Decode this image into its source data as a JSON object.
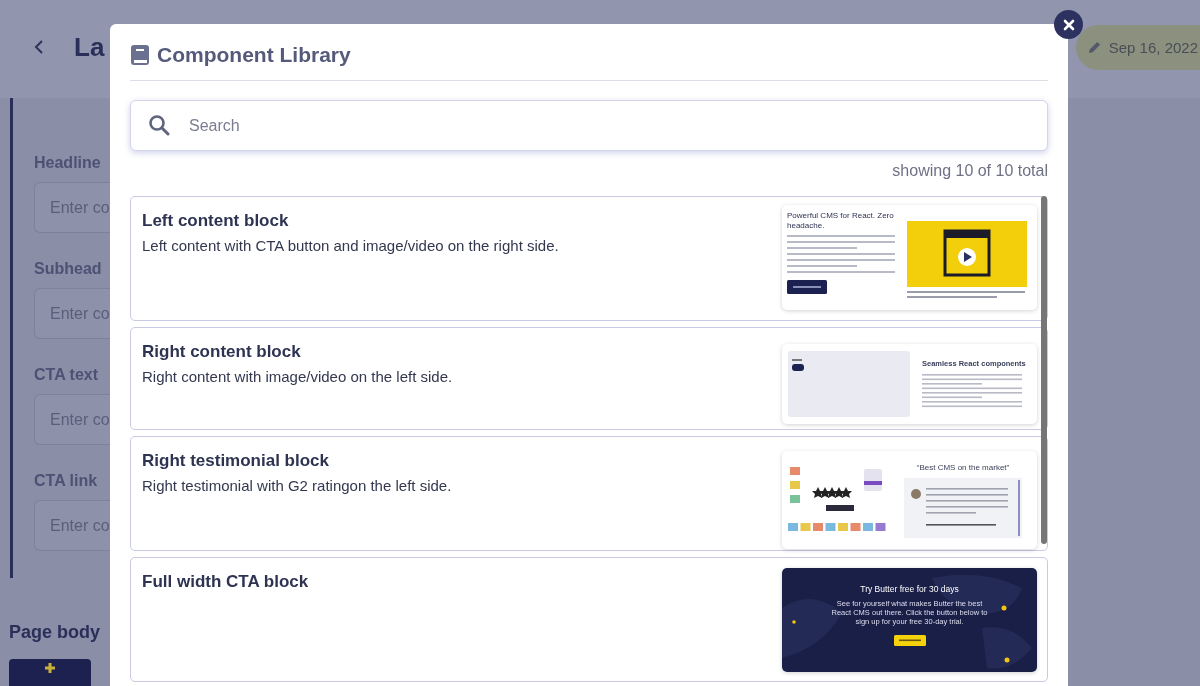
{
  "background_page": {
    "title": "La",
    "date_badge": "Sep 16, 2022",
    "fields": [
      {
        "label": "Headline",
        "placeholder": "Enter co"
      },
      {
        "label": "Subhead",
        "placeholder": "Enter co"
      },
      {
        "label": "CTA text",
        "placeholder": "Enter co"
      },
      {
        "label": "CTA link",
        "placeholder": "Enter co"
      }
    ],
    "section_title": "Page body"
  },
  "modal": {
    "title": "Component Library",
    "search": {
      "placeholder": "Search"
    },
    "result_count": "showing 10 of 10 total",
    "components": [
      {
        "name": "Left content block",
        "description": "Left content with CTA button and image/video on the right side.",
        "preview": {
          "kind": "left-content",
          "heading": "Powerful CMS for React. Zero headache."
        }
      },
      {
        "name": "Right content block",
        "description": "Right content with image/video on the left side.",
        "preview": {
          "kind": "right-content",
          "heading": "Seamless React components"
        }
      },
      {
        "name": "Right testimonial block",
        "description": "Right testimonial with G2 ratingon the left side.",
        "preview": {
          "kind": "testimonial",
          "heading": "“Best CMS on the market”"
        }
      },
      {
        "name": "Full width CTA block",
        "preview": {
          "kind": "cta",
          "heading": "Try Butter free for 30 days",
          "body": "See for yourself what makes Butter the best React CMS out there. Click the button below to sign up for your free 30-day trial."
        }
      }
    ]
  }
}
